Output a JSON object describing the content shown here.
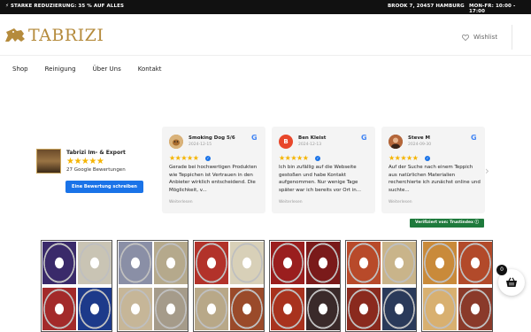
{
  "topbar": {
    "promo": "⚡ STARKE REDUZIERUNG: 35 % AUF ALLES",
    "address": "BROOK 7, 20457 HAMBURG",
    "hours": "MON-FR: 10:00 - 17:00"
  },
  "header": {
    "logo_text": "TABRIZI",
    "wishlist_label": "Wishlist"
  },
  "nav": {
    "items": [
      {
        "label": "Shop"
      },
      {
        "label": "Reinigung"
      },
      {
        "label": "Über Uns"
      },
      {
        "label": "Kontakt"
      }
    ]
  },
  "business": {
    "name": "Tabrizi Im- & Export",
    "stars": "★★★★★",
    "rating": 5,
    "reviews_count": "27 Google Bewertungen",
    "write_review_button": "Eine Bewertung schreiben"
  },
  "reviews": [
    {
      "avatar_letter": "",
      "avatar_color": "#c58b3b",
      "name": "Smoking Dog 5/6",
      "date": "2024-12-15",
      "stars": "★★★★★",
      "rating": 5,
      "text": "Gerade bei hochwertigen Produkten wie Teppichen ist Vertrauen in den Anbieter wirklich entscheidend. Die Möglichkeit, v...",
      "more": "Weiterlesen"
    },
    {
      "avatar_letter": "B",
      "avatar_color": "#e8472b",
      "name": "Ben Kleist",
      "date": "2024-12-13",
      "stars": "★★★★★",
      "rating": 5,
      "text": "Ich bin zufällig auf die Webseite gestoßen und habe Kontakt aufgenommen. Nur wenige Tage später war ich bereits vor Ort in...",
      "more": "Weiterlesen"
    },
    {
      "avatar_letter": "",
      "avatar_color": "#8a4a2a",
      "name": "Steve M",
      "date": "2024-09-30",
      "stars": "★★★★★",
      "rating": 5,
      "text": "Auf der Suche nach einem Teppich aus natürlichen Materialien recherchierte ich zunächst online und suchte...",
      "more": "Weiterlesen"
    }
  ],
  "google_badge": "G",
  "trustindex_label": "Verifiziert von: Trustindex ⓘ",
  "cart": {
    "count": "0",
    "icon": "basket-icon"
  },
  "colors": {
    "accent_gold": "#b58b3c",
    "star": "#f5b400",
    "button_blue": "#1a73e8",
    "trust_green": "#1e7a3c",
    "topbar": "#111111"
  },
  "rug_palettes": [
    [
      "#3a2a6a",
      "#c9c4b4",
      "#a32a2a",
      "#1d3a8a"
    ],
    [
      "#8a8fa6",
      "#b5a98c",
      "#c6b698",
      "#a59b8a"
    ],
    [
      "#b2322a",
      "#d8d0b8",
      "#b8a888",
      "#9a4a2a"
    ],
    [
      "#9a1e1e",
      "#7a1a1a",
      "#a8321e",
      "#3a2a2a"
    ],
    [
      "#b84a2a",
      "#c9b48a",
      "#8a2a1e",
      "#2a3a5a"
    ],
    [
      "#c98a3a",
      "#b24a2a",
      "#d8b070",
      "#8a3a2a"
    ]
  ]
}
